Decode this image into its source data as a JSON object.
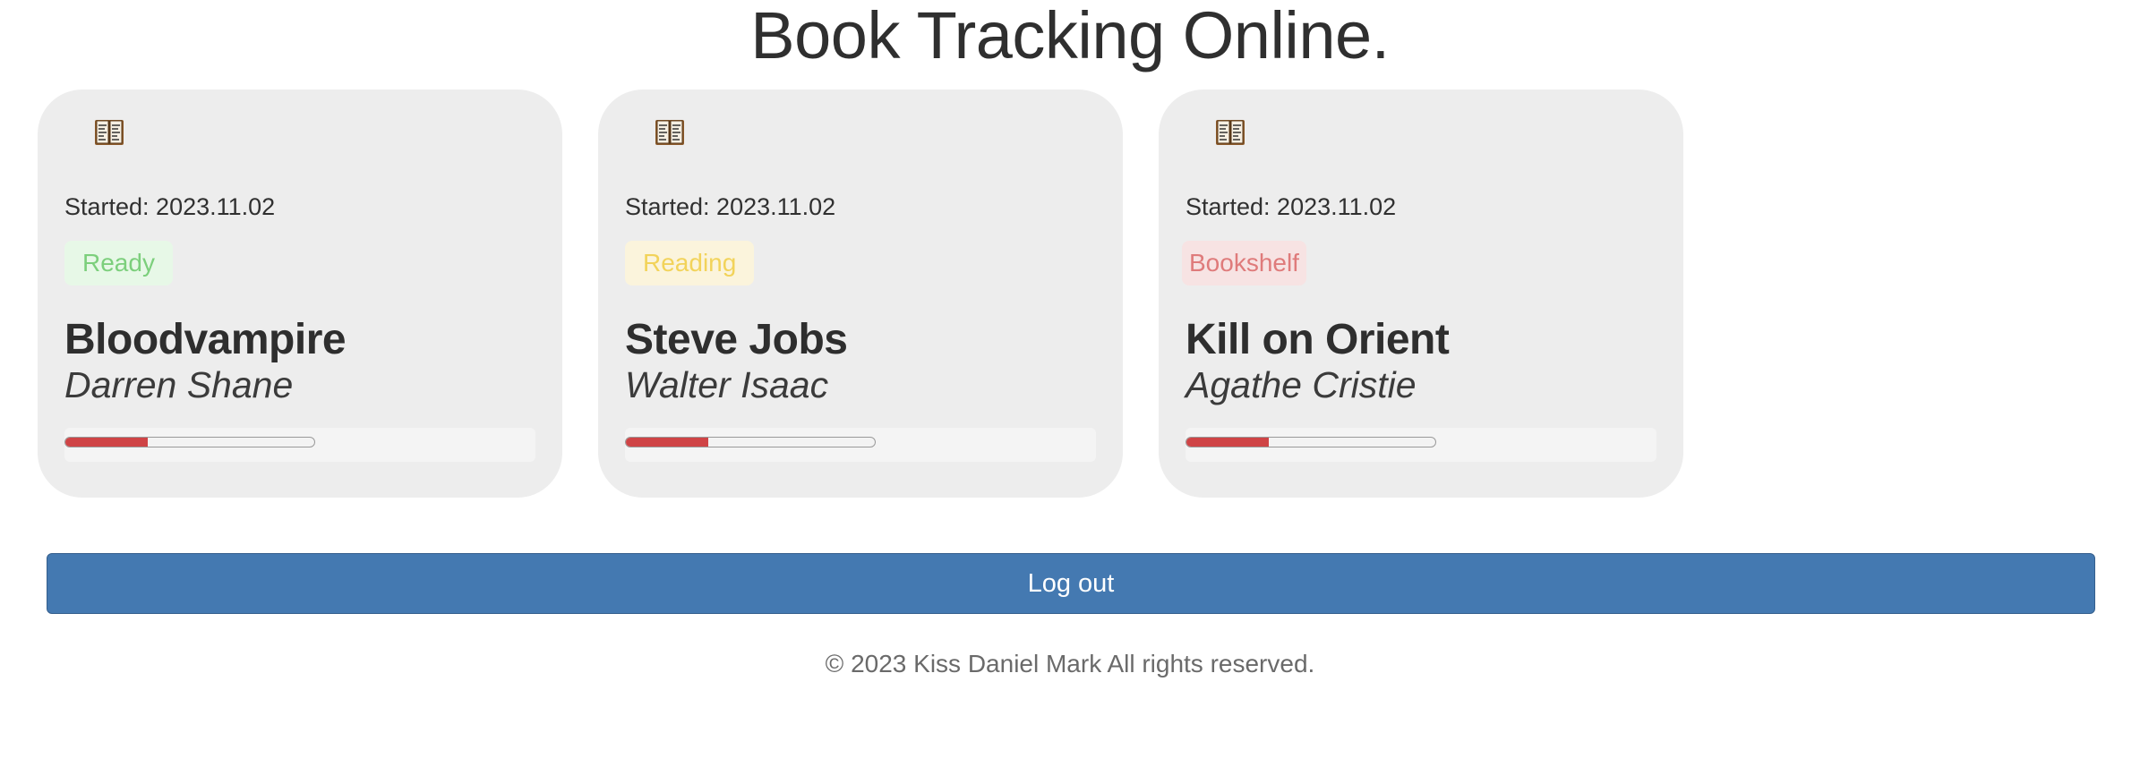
{
  "header": {
    "title": "Book Tracking Online."
  },
  "books": [
    {
      "icon": "open-book-icon",
      "started": "Started: 2023.11.02",
      "status": "Ready",
      "title": "Bloodvampire",
      "author": "Darren Shane",
      "progress": 0.33
    },
    {
      "icon": "open-book-icon",
      "started": "Started: 2023.11.02",
      "status": "Reading",
      "title": "Steve Jobs",
      "author": "Walter Isaac",
      "progress": 0.33
    },
    {
      "icon": "open-book-icon",
      "started": "Started: 2023.11.02",
      "status": "Bookshelf",
      "title": "Kill on Orient",
      "author": "Agathe Cristie",
      "progress": 0.33
    }
  ],
  "status_colors": {
    "Ready": "#7ccf7c",
    "Reading": "#f2d35a",
    "Bookshelf": "#df7b7b"
  },
  "accent_color": "#4479b1",
  "progress_color": "#cf4446",
  "actions": {
    "logout_label": "Log out"
  },
  "footer": {
    "text": "© 2023 Kiss Daniel Mark All rights reserved."
  }
}
